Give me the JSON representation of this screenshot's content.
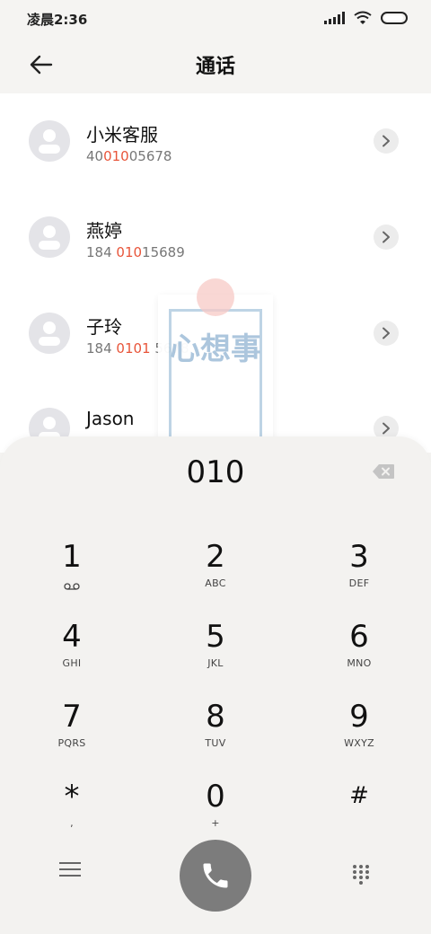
{
  "status_bar": {
    "time": "凌晨2:36"
  },
  "header": {
    "title": "通话"
  },
  "contacts": [
    {
      "name": "小米客服",
      "number_pre": "40",
      "number_hl": "010",
      "number_post": "05678"
    },
    {
      "name": "燕婷",
      "number_pre": "184 ",
      "number_hl": "010",
      "number_post": "15689"
    },
    {
      "name": "子玲",
      "number_pre": "184 ",
      "number_hl": "0101",
      "number_post": " 5678"
    },
    {
      "name": "Jason",
      "number_pre": "",
      "number_hl": "",
      "number_post": ""
    }
  ],
  "watermark": {
    "text": "心想事"
  },
  "dialer": {
    "display": "010",
    "keys": [
      {
        "digit": "1",
        "letters": ""
      },
      {
        "digit": "2",
        "letters": "ABC"
      },
      {
        "digit": "3",
        "letters": "DEF"
      },
      {
        "digit": "4",
        "letters": "GHI"
      },
      {
        "digit": "5",
        "letters": "JKL"
      },
      {
        "digit": "6",
        "letters": "MNO"
      },
      {
        "digit": "7",
        "letters": "PQRS"
      },
      {
        "digit": "8",
        "letters": "TUV"
      },
      {
        "digit": "9",
        "letters": "WXYZ"
      },
      {
        "digit": "*",
        "letters": ","
      },
      {
        "digit": "0",
        "letters": "+"
      },
      {
        "digit": "#",
        "letters": ""
      }
    ]
  },
  "icons": {
    "back": "arrow-left-icon",
    "detail": "chevron-right-icon",
    "backspace": "backspace-icon",
    "voicemail": "voicemail-icon",
    "menu": "menu-icon",
    "call": "phone-icon",
    "keypad": "keypad-icon"
  },
  "colors": {
    "highlight": "#e8553a",
    "call_button": "#7c7c7c",
    "avatar": "#e4e4e8"
  }
}
